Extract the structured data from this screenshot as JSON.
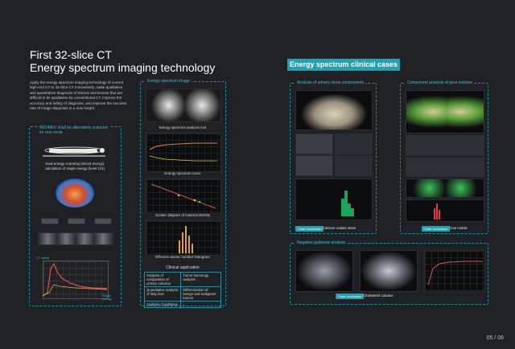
{
  "header": {
    "title_line1": "First 32-slice CT",
    "title_line2": "Energy spectrum imaging technology",
    "intro": "Apply the energy spectrum imaging technology of current high-end CT to 32-slice CT innovatively, make qualitative and quantitative diagnosis of lesions and tissues that are difficult to be qualitative by conventional CT, improve the accuracy and safety of diagnosis, and improve the success rate of image diagnosis to a new height."
  },
  "left_box": {
    "title": "80/140kV shall be alternately scanned for one circle",
    "caption": "Dual energy scanning (mixed energy) calculation of single energy (level 101)",
    "ct_chart_label": "CT value",
    "ct_chart_xlabel": "Single energy"
  },
  "middle": {
    "energy_image_title": "Energy spectrum image",
    "tool_label": "Energy spectrum analysis tool",
    "curve_label": "Energy spectrum curve",
    "scatter_label": "Scatter diagram of material density",
    "histogram_label": "Effective atomic number histogram",
    "clinical_title": "Clinical application",
    "clinical_rows": [
      [
        "Analysis of composition of urinary calculus",
        "Tumor homology analysis"
      ],
      [
        "Quantitative analysis of fatty liver",
        "Differentiation of benign and malignant tumors"
      ],
      [
        "Analysis of gallstone",
        "..."
      ]
    ]
  },
  "right": {
    "panel_title": "Energy spectrum clinical cases",
    "urinary_title": "Analysis of urinary stone components",
    "gout_title": "Component analysis of gout nodules",
    "urinary_conclusion_chip": "Case conclusion",
    "urinary_conclusion_text": "Calcium oxalate stone",
    "gout_conclusion_chip": "Case conclusion",
    "gout_conclusion_text": "Gout nodule",
    "gallstone_title": "Negative gallstone analysis",
    "gallstone_conclusion_chip": "Case conclusion",
    "gallstone_conclusion_text": "Cholesterol calculus"
  },
  "pager": "05 / 06",
  "colors": {
    "accent": "#1ba4b5",
    "dash": "#1b8fa0",
    "background": "#1f2124",
    "histogram_green": "#1aa55a",
    "histogram_red": "#e23b3b",
    "chart_line": "#e05050"
  }
}
